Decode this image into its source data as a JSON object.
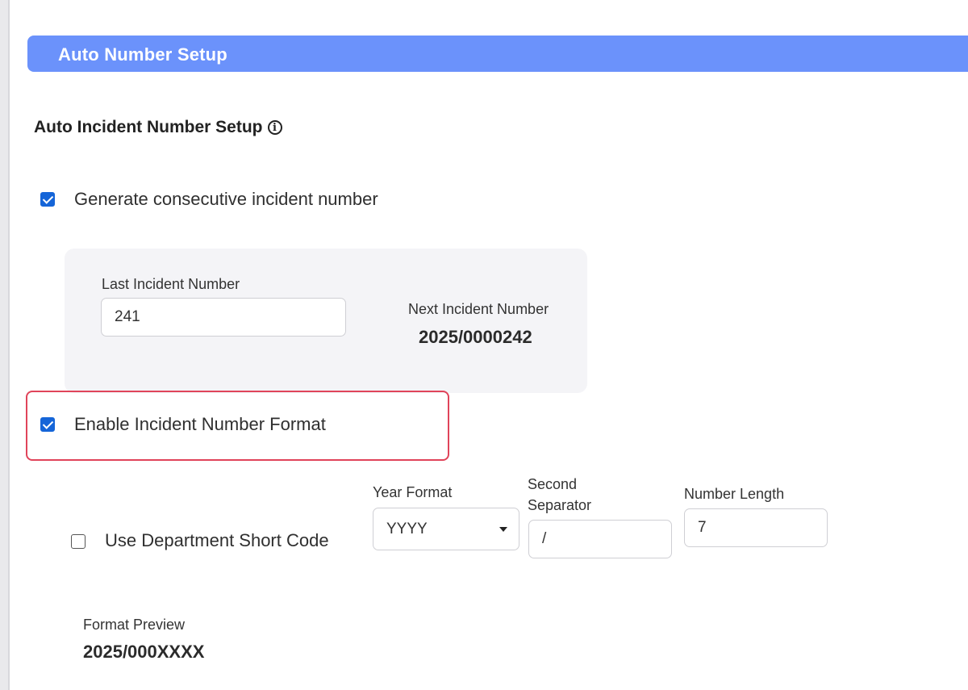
{
  "header": {
    "title": "Auto Number Setup"
  },
  "section": {
    "title": "Auto Incident Number Setup",
    "info_icon": "info-icon"
  },
  "consecutive": {
    "label": "Generate consecutive incident number",
    "checked": true
  },
  "last_incident": {
    "label": "Last Incident Number",
    "value": "241"
  },
  "next_incident": {
    "label": "Next Incident Number",
    "value": "2025/0000242"
  },
  "enable_format": {
    "label": "Enable Incident Number Format",
    "checked": true
  },
  "department_code": {
    "label": "Use Department Short Code",
    "checked": false
  },
  "year_format": {
    "label": "Year Format",
    "value": "YYYY"
  },
  "second_separator": {
    "label_line1": "Second",
    "label_line2": "Separator",
    "value": "/"
  },
  "number_length": {
    "label": "Number Length",
    "value": "7"
  },
  "format_preview": {
    "label": "Format Preview",
    "value": "2025/000XXXX"
  },
  "colors": {
    "header_bg": "#6b92fb",
    "checkbox": "#1565d8",
    "highlight": "#e0445a"
  }
}
